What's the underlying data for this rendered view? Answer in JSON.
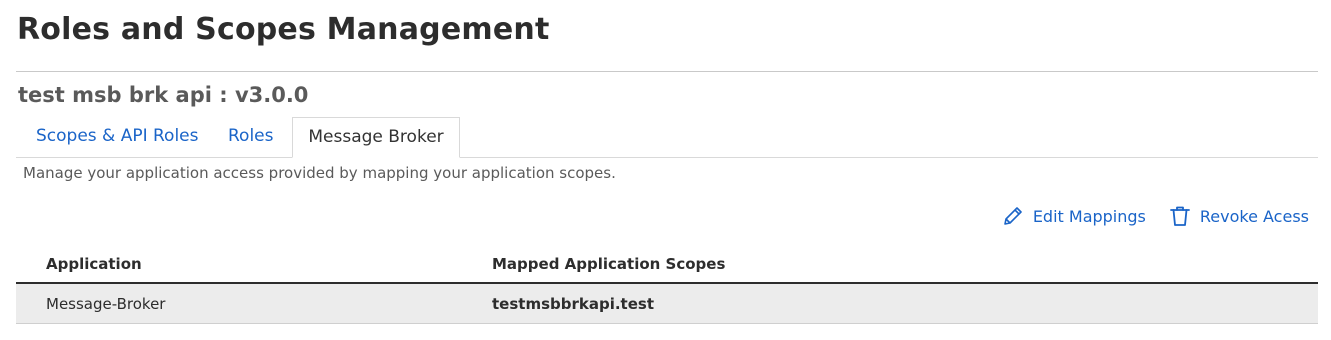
{
  "page": {
    "title": "Roles and Scopes Management",
    "subtitle": "test msb brk api : v3.0.0",
    "description": "Manage your application access provided by mapping your application scopes."
  },
  "tabs": [
    {
      "label": "Scopes & API Roles",
      "active": false
    },
    {
      "label": "Roles",
      "active": false
    },
    {
      "label": "Message Broker",
      "active": true
    }
  ],
  "actions": {
    "edit_mappings": {
      "label": "Edit Mappings",
      "icon": "pencil-icon"
    },
    "revoke_access": {
      "label": "Revoke Acess",
      "icon": "trash-icon"
    }
  },
  "table": {
    "columns": [
      "Application",
      "Mapped Application Scopes"
    ],
    "rows": [
      {
        "application": "Message-Broker",
        "scopes": "testmsbbrkapi.test"
      }
    ]
  },
  "colors": {
    "link": "#1a64c8",
    "text": "#2d2d2d",
    "row_background": "#ececec"
  }
}
